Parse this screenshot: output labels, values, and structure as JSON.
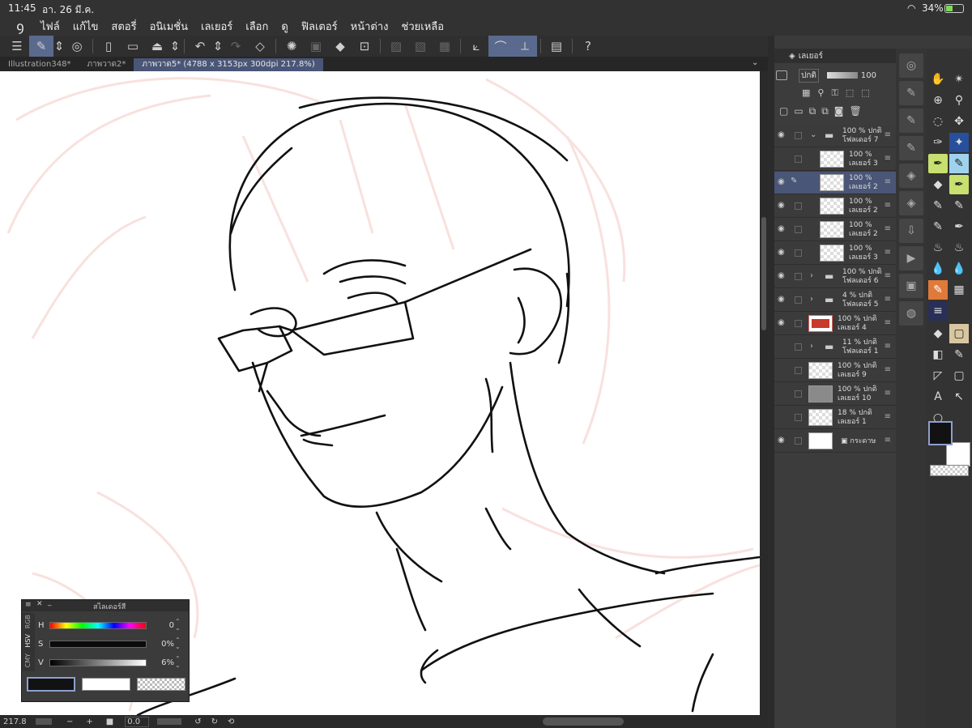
{
  "status": {
    "time": "11:45",
    "date": "อา. 26 มี.ค.",
    "battery": "34%"
  },
  "menu": [
    "ไฟล์",
    "แก้ไข",
    "สตอรี่",
    "อนิเมชั่น",
    "เลเยอร์",
    "เลือก",
    "ดู",
    "ฟิลเตอร์",
    "หน้าต่าง",
    "ช่วยเหลือ"
  ],
  "tabs": [
    {
      "label": "Illustration348*"
    },
    {
      "label": "ภาพวาด2*"
    },
    {
      "label": "ภาพวาด5* (4788 x 3153px 300dpi 217.8%)"
    }
  ],
  "layer_panel": {
    "title": "เลเยอร์",
    "blend_mode": "ปกติ",
    "opacity": "100",
    "layers": [
      {
        "pct": "100 %",
        "mode": "ปกติ",
        "name": "โฟลเดอร์ 7",
        "type": "folder",
        "eye": true
      },
      {
        "pct": "100 %",
        "mode": "",
        "name": "เลเยอร์ 3",
        "type": "raster",
        "eye": false
      },
      {
        "pct": "100 %",
        "mode": "",
        "name": "เลเยอร์ 2",
        "type": "raster",
        "eye": true,
        "selected": true
      },
      {
        "pct": "100 %",
        "mode": "",
        "name": "เลเยอร์ 2",
        "type": "raster",
        "eye": true
      },
      {
        "pct": "100 %",
        "mode": "",
        "name": "เลเยอร์ 2",
        "type": "raster",
        "eye": true
      },
      {
        "pct": "100 %",
        "mode": "",
        "name": "เลเยอร์ 3",
        "type": "raster",
        "eye": true
      },
      {
        "pct": "100 %",
        "mode": "ปกติ",
        "name": "โฟลเดอร์ 6",
        "type": "folder",
        "eye": true
      },
      {
        "pct": "4 %",
        "mode": "ปกติ",
        "name": "โฟลเดอร์ 5",
        "type": "folder",
        "eye": true
      },
      {
        "pct": "100 %",
        "mode": "ปกติ",
        "name": "เลเยอร์ 4",
        "type": "red",
        "eye": true
      },
      {
        "pct": "11 %",
        "mode": "ปกติ",
        "name": "โฟลเดอร์ 1",
        "type": "folder",
        "eye": false
      },
      {
        "pct": "100 %",
        "mode": "ปกติ",
        "name": "เลเยอร์ 9",
        "type": "raster",
        "eye": false
      },
      {
        "pct": "100 %",
        "mode": "ปกติ",
        "name": "เลเยอร์ 10",
        "type": "gray",
        "eye": false
      },
      {
        "pct": "18 %",
        "mode": "ปกติ",
        "name": "เลเยอร์ 1",
        "type": "raster",
        "eye": false
      },
      {
        "pct": "",
        "mode": "",
        "name": "กระดาษ",
        "type": "paper",
        "eye": true
      }
    ]
  },
  "color_slider": {
    "title": "สไลเดอร์สี",
    "modes": [
      "RGB",
      "HSV",
      "CMY"
    ],
    "h_label": "H",
    "h_value": "0",
    "s_label": "S",
    "s_value": "0%",
    "v_label": "V",
    "v_value": "6%"
  },
  "bottom_bar": {
    "zoom": "217.8",
    "rotation": "0.0"
  },
  "colors": {
    "accent": "#4a5677",
    "toolbar_bg": "#2f2f2f",
    "main_color": "#121212",
    "sub_color": "#ffffff",
    "sketch_red": "#f3c9c4",
    "layer4_red": "#c83a2b",
    "pen_highlight": "#c7e06f"
  }
}
